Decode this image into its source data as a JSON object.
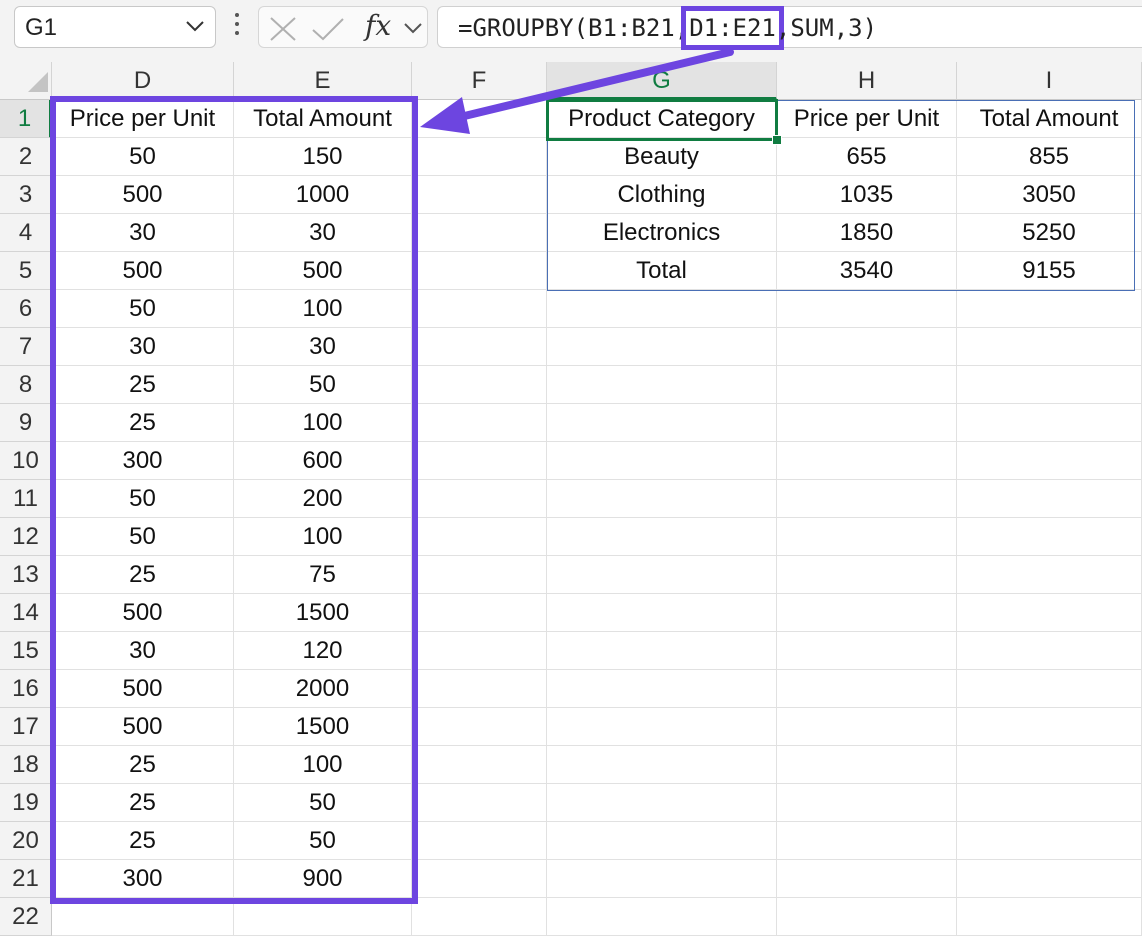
{
  "formula_bar": {
    "name_box": "G1",
    "formula_prefix": "=GROUPBY(B1:B21,",
    "formula_highlight": "D1:E21",
    "formula_suffix": ",SUM,3)"
  },
  "columns": [
    "D",
    "E",
    "F",
    "G",
    "H",
    "I"
  ],
  "rows": [
    "1",
    "2",
    "3",
    "4",
    "5",
    "6",
    "7",
    "8",
    "9",
    "10",
    "11",
    "12",
    "13",
    "14",
    "15",
    "16",
    "17",
    "18",
    "19",
    "20",
    "21",
    "22"
  ],
  "source_table": {
    "headers": [
      "Price per Unit",
      "Total Amount"
    ],
    "rows": [
      [
        "50",
        "150"
      ],
      [
        "500",
        "1000"
      ],
      [
        "30",
        "30"
      ],
      [
        "500",
        "500"
      ],
      [
        "50",
        "100"
      ],
      [
        "30",
        "30"
      ],
      [
        "25",
        "50"
      ],
      [
        "25",
        "100"
      ],
      [
        "300",
        "600"
      ],
      [
        "50",
        "200"
      ],
      [
        "50",
        "100"
      ],
      [
        "25",
        "75"
      ],
      [
        "500",
        "1500"
      ],
      [
        "30",
        "120"
      ],
      [
        "500",
        "2000"
      ],
      [
        "500",
        "1500"
      ],
      [
        "25",
        "100"
      ],
      [
        "25",
        "50"
      ],
      [
        "25",
        "50"
      ],
      [
        "300",
        "900"
      ]
    ]
  },
  "result_table": {
    "headers": [
      "Product Category",
      "Price per Unit",
      "Total Amount"
    ],
    "rows": [
      [
        "Beauty",
        "655",
        "855"
      ],
      [
        "Clothing",
        "1035",
        "3050"
      ],
      [
        "Electronics",
        "1850",
        "5250"
      ],
      [
        "Total",
        "3540",
        "9155"
      ]
    ]
  },
  "colors": {
    "highlight": "#6d45e0",
    "selection": "#107c41",
    "table_border": "#4a6fb5"
  }
}
